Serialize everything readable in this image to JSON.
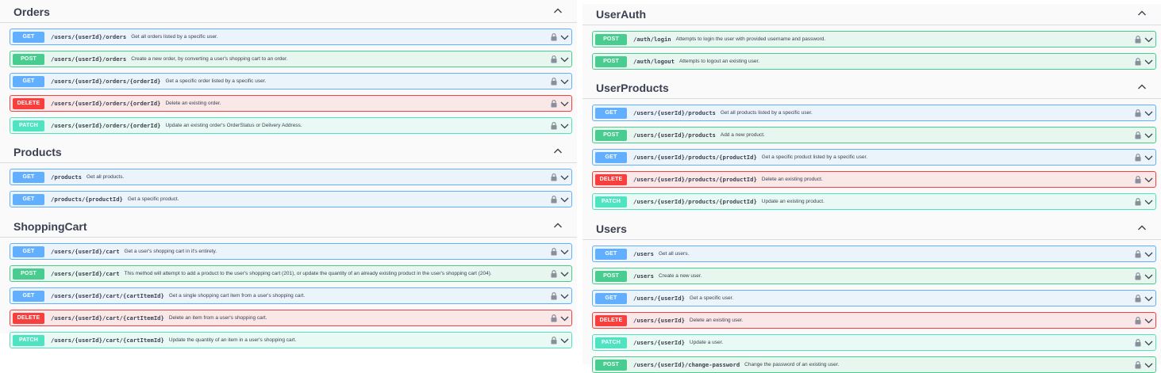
{
  "left": {
    "sections": [
      {
        "title": "Orders",
        "ops": [
          {
            "method": "GET",
            "path": "/users/{userId}/orders",
            "summary": "Get all orders listed by a specific user."
          },
          {
            "method": "POST",
            "path": "/users/{userId}/orders",
            "summary": "Create a new order, by converting a user's shopping cart to an order."
          },
          {
            "method": "GET",
            "path": "/users/{userId}/orders/{orderId}",
            "summary": "Get a specific order listed by a specific user."
          },
          {
            "method": "DELETE",
            "path": "/users/{userId}/orders/{orderId}",
            "summary": "Delete an existing order."
          },
          {
            "method": "PATCH",
            "path": "/users/{userId}/orders/{orderId}",
            "summary": "Update an existing order's OrderStatus or Delivery Address."
          }
        ]
      },
      {
        "title": "Products",
        "ops": [
          {
            "method": "GET",
            "path": "/products",
            "summary": "Get all products."
          },
          {
            "method": "GET",
            "path": "/products/{productId}",
            "summary": "Get a specific product."
          }
        ]
      },
      {
        "title": "ShoppingCart",
        "ops": [
          {
            "method": "GET",
            "path": "/users/{userId}/cart",
            "summary": "Get a user's shopping cart in it's entirety."
          },
          {
            "method": "POST",
            "path": "/users/{userId}/cart",
            "summary": "This method will attempt to add a product to the user's shopping cart (201), or update the quantity of an already existing product in the user's shopping cart (204)."
          },
          {
            "method": "GET",
            "path": "/users/{userId}/cart/{cartItemId}",
            "summary": "Get a single shopping cart item from a user's shopping cart."
          },
          {
            "method": "DELETE",
            "path": "/users/{userId}/cart/{cartItemId}",
            "summary": "Delete an item from a user's shopping cart."
          },
          {
            "method": "PATCH",
            "path": "/users/{userId}/cart/{cartItemId}",
            "summary": "Update the quantity of an item in a user's shopping cart."
          }
        ]
      }
    ]
  },
  "right": {
    "sections": [
      {
        "title": "UserAuth",
        "ops": [
          {
            "method": "POST",
            "path": "/auth/login",
            "summary": "Attempts to login the user with provided username and password."
          },
          {
            "method": "POST",
            "path": "/auth/logout",
            "summary": "Attempts to logout an existing user."
          }
        ]
      },
      {
        "title": "UserProducts",
        "ops": [
          {
            "method": "GET",
            "path": "/users/{userId}/products",
            "summary": "Get all products listed by a specific user."
          },
          {
            "method": "POST",
            "path": "/users/{userId}/products",
            "summary": "Add a new product."
          },
          {
            "method": "GET",
            "path": "/users/{userId}/products/{productId}",
            "summary": "Get a specific product listed by a specific user."
          },
          {
            "method": "DELETE",
            "path": "/users/{userId}/products/{productId}",
            "summary": "Delete an existing product."
          },
          {
            "method": "PATCH",
            "path": "/users/{userId}/products/{productId}",
            "summary": "Update an existing product."
          }
        ]
      },
      {
        "title": "Users",
        "ops": [
          {
            "method": "GET",
            "path": "/users",
            "summary": "Get all users."
          },
          {
            "method": "POST",
            "path": "/users",
            "summary": "Create a new user."
          },
          {
            "method": "GET",
            "path": "/users/{userId}",
            "summary": "Get a specific user."
          },
          {
            "method": "DELETE",
            "path": "/users/{userId}",
            "summary": "Delete an existing user."
          },
          {
            "method": "PATCH",
            "path": "/users/{userId}",
            "summary": "Update a user."
          },
          {
            "method": "POST",
            "path": "/users/{userId}/change-password",
            "summary": "Change the password of an existing user."
          }
        ]
      }
    ]
  },
  "icons": {
    "lock": "lock-icon",
    "chevron_down": "chevron-down-icon",
    "chevron_up": "chevron-up-icon"
  },
  "colors": {
    "get": "#61affe",
    "post": "#49cc90",
    "delete": "#f93e3e",
    "patch": "#50e3c2",
    "text": "#3b4151"
  }
}
